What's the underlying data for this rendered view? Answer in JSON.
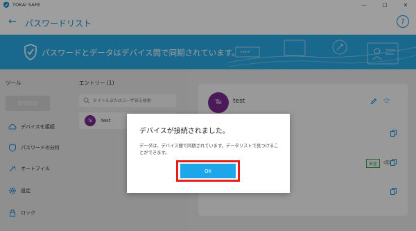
{
  "window": {
    "app_title": "TOKAI SAFE",
    "controls": {
      "minimize": "—",
      "maximize": "☐",
      "close": "✕"
    }
  },
  "header": {
    "back_icon": "←",
    "title": "パスワードリスト",
    "help_icon": "?"
  },
  "banner": {
    "text": "パスワードとデータはデバイス間で同期されています。",
    "password_mask": "****"
  },
  "sidebar": {
    "heading": "ツール",
    "new_button": "新規追加",
    "items": [
      {
        "icon": "cloud-sync-icon",
        "label": "デバイスを接続"
      },
      {
        "icon": "shield-analysis-icon",
        "label": "パスワードの分析"
      },
      {
        "icon": "autofill-icon",
        "label": "オートフィル"
      },
      {
        "icon": "gear-icon",
        "label": "設定"
      },
      {
        "icon": "lock-icon",
        "label": "ロック"
      }
    ]
  },
  "entries": {
    "heading": "エントリー (1)",
    "search_placeholder": "タイトルまたはユーザ名を検索",
    "list": [
      {
        "initials": "Te",
        "name": "test"
      }
    ]
  },
  "detail": {
    "initials": "Te",
    "name": "test",
    "safe_badge": "安全"
  },
  "dialog": {
    "title": "デバイスが接続されました。",
    "message": "データは、デバイス間で同期されています。データリストで見つけることができます。",
    "ok_label": "OK"
  },
  "colors": {
    "accent": "#1a8fd6",
    "banner": "#29a9e6",
    "ok_button": "#1da6ea",
    "highlight": "#e3201b",
    "avatar": "#7a2b8f"
  }
}
